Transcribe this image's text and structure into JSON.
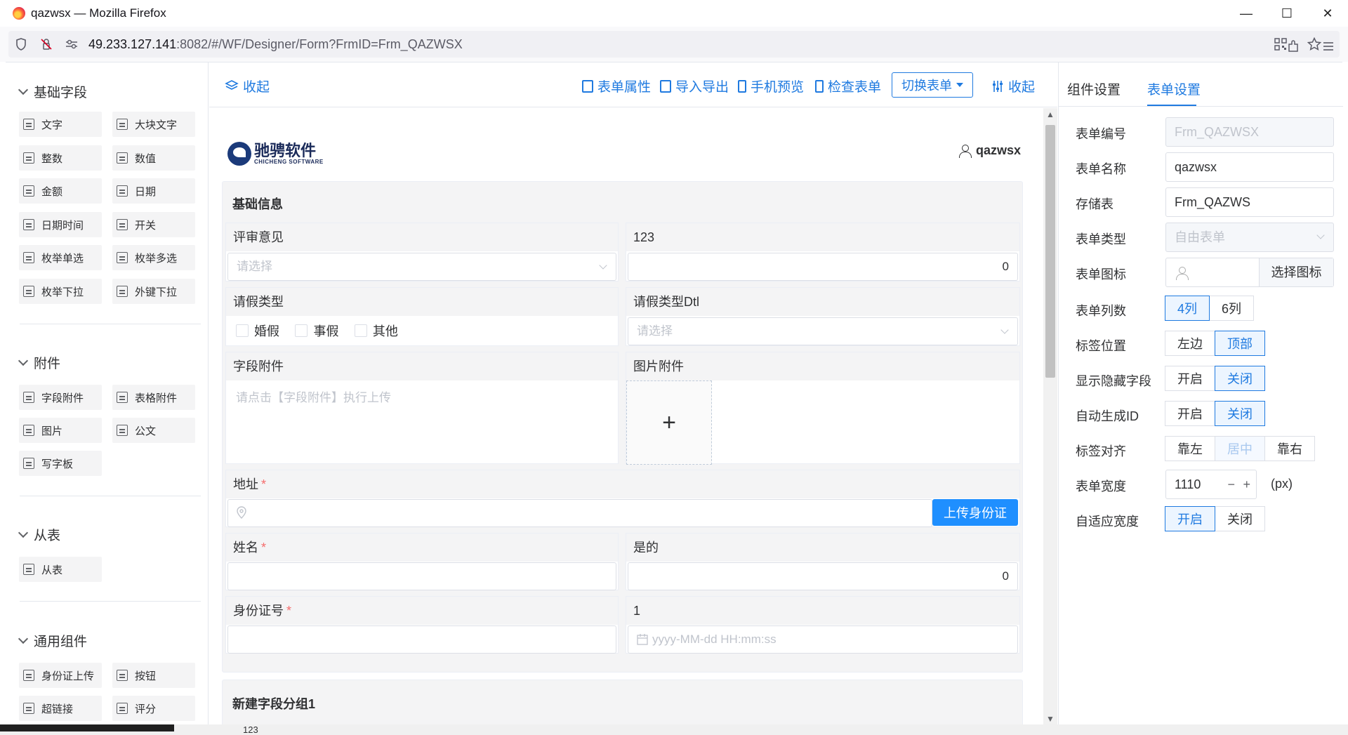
{
  "window": {
    "title": "qazwsx — Mozilla Firefox",
    "min": "—",
    "max": "☐",
    "close": "✕"
  },
  "browser": {
    "url_host": "49.233.127.141",
    "url_rest": ":8082/#/WF/Designer/Form?FrmID=Frm_QAZWSX"
  },
  "left_panel": {
    "groups": [
      {
        "title": "基础字段",
        "items": [
          "文字",
          "大块文字",
          "整数",
          "数值",
          "金额",
          "日期",
          "日期时间",
          "开关",
          "枚举单选",
          "枚举多选",
          "枚举下拉",
          "外键下拉"
        ]
      },
      {
        "title": "附件",
        "items": [
          "字段附件",
          "表格附件",
          "图片",
          "公文",
          "写字板"
        ]
      },
      {
        "title": "从表",
        "items": [
          "从表"
        ]
      },
      {
        "title": "通用组件",
        "items": [
          "身份证上传",
          "按钮",
          "超链接",
          "评分"
        ]
      }
    ]
  },
  "toolbar": {
    "collapse_left": "收起",
    "form_props": "表单属性",
    "import_export": "导入导出",
    "mobile_preview": "手机预览",
    "check_form": "检查表单",
    "switch_form": "切换表单",
    "collapse_right": "收起"
  },
  "form": {
    "logo_cn": "驰骋软件",
    "logo_en": "CHICHENG SOFTWARE",
    "user": "qazwsx",
    "section1_title": "基础信息",
    "fields": {
      "review_label": "评审意见",
      "review_placeholder": "请选择",
      "f123_label": "123",
      "f123_value": "0",
      "leave_type_label": "请假类型",
      "leave_options": [
        "婚假",
        "事假",
        "其他"
      ],
      "leave_dtl_label": "请假类型Dtl",
      "leave_dtl_placeholder": "请选择",
      "field_attach_label": "字段附件",
      "field_attach_hint": "请点击【字段附件】执行上传",
      "image_attach_label": "图片附件",
      "image_plus": "+",
      "address_label": "地址",
      "upload_id_btn": "上传身份证",
      "name_label": "姓名",
      "yes_label": "是的",
      "yes_value": "0",
      "idno_label": "身份证号",
      "one_label": "1",
      "date_placeholder": "yyyy-MM-dd HH:mm:ss",
      "required_mark": "*"
    },
    "section2_title": "新建字段分组1"
  },
  "right_panel": {
    "tab_component": "组件设置",
    "tab_form": "表单设置",
    "props": {
      "form_no_label": "表单编号",
      "form_no_value": "Frm_QAZWSX",
      "form_name_label": "表单名称",
      "form_name_value": "qazwsx",
      "storage_label": "存储表",
      "storage_value": "Frm_QAZWS",
      "form_type_label": "表单类型",
      "form_type_value": "自由表单",
      "form_icon_label": "表单图标",
      "select_icon": "选择图标",
      "columns_label": "表单列数",
      "col4": "4列",
      "col6": "6列",
      "label_pos_label": "标签位置",
      "left": "左边",
      "top": "顶部",
      "show_hidden_label": "显示隐藏字段",
      "on": "开启",
      "off": "关闭",
      "auto_id_label": "自动生成ID",
      "align_label": "标签对齐",
      "align_left": "靠左",
      "align_center": "居中",
      "align_right": "靠右",
      "width_label": "表单宽度",
      "width_value": "1110",
      "width_unit": "(px)",
      "minus": "−",
      "plus": "+",
      "adaptive_label": "自适应宽度"
    }
  },
  "bottom_bleed": "123"
}
